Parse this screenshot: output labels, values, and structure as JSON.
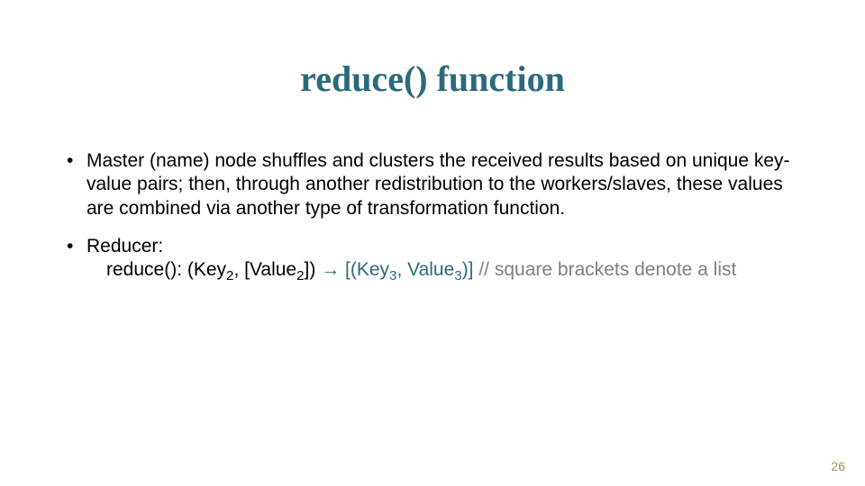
{
  "title": "reduce() function",
  "bullets": {
    "b1": "Master (name) node shuffles and clusters the received results based on unique key-value pairs; then, through another redistribution to the workers/slaves, these values are combined via another type of transformation function.",
    "b2": "Reducer:"
  },
  "signature": {
    "prefix": "reduce(): (Key",
    "sub_a": "2",
    "mid1": ", [Value",
    "sub_b": "2",
    "mid2": "]) ",
    "arrow": "→",
    "post_arrow": " [(Key",
    "sub_c": "3",
    "mid3": ", Value",
    "sub_d": "3",
    "tail": ")]",
    "comment_sep": "   // ",
    "comment": "square brackets denote a list"
  },
  "page_number": "26"
}
